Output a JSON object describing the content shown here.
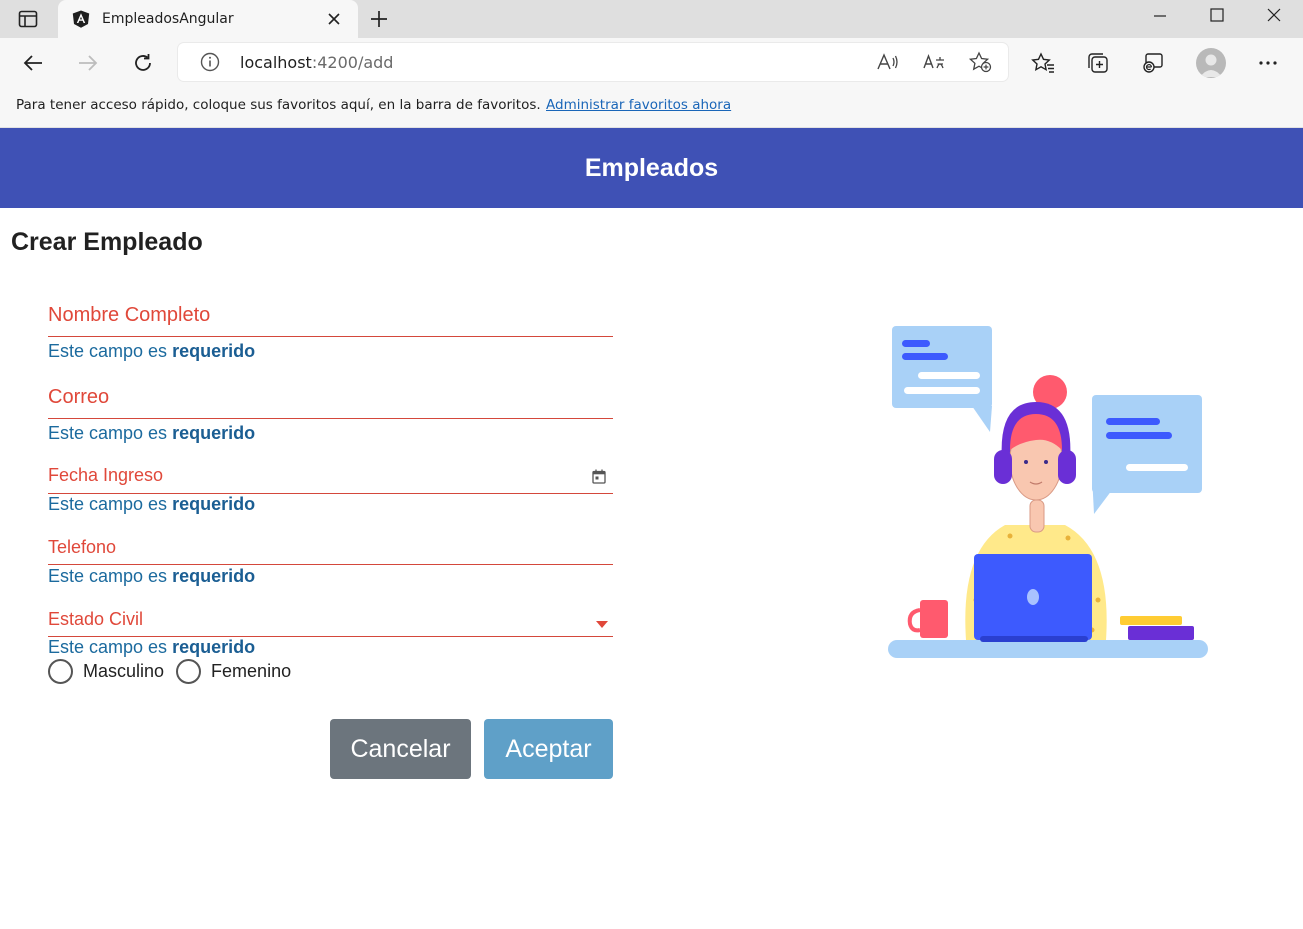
{
  "browser": {
    "tab_title": "EmpleadosAngular",
    "url_host": "localhost",
    "url_path": ":4200/add",
    "favorites_bar_text": "Para tener acceso rápido, coloque sus favoritos aquí, en la barra de favoritos.",
    "favorites_bar_link": "Administrar favoritos ahora"
  },
  "app": {
    "header_title": "Empleados",
    "page_title": "Crear Empleado"
  },
  "form": {
    "error_prefix": "Este campo es ",
    "error_emphasis": "requerido",
    "fields": [
      {
        "label": "Nombre Completo"
      },
      {
        "label": "Correo"
      },
      {
        "label": "Fecha Ingreso"
      },
      {
        "label": "Telefono"
      },
      {
        "label": "Estado Civil"
      }
    ],
    "gender_options": [
      "Masculino",
      "Femenino"
    ],
    "cancel_label": "Cancelar",
    "accept_label": "Aceptar"
  },
  "colors": {
    "header_bg": "#3f51b5",
    "field_error_red": "#e0483a",
    "hint_blue": "#1b6a9e",
    "cancel_bg": "#6c757d",
    "accept_bg": "#5fa0c8"
  }
}
